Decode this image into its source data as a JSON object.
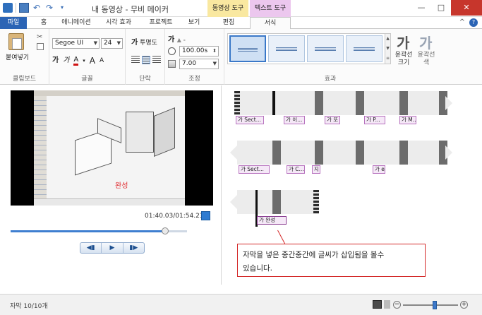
{
  "window": {
    "title": "내 동영상 - 무비 메이커",
    "context_tabs": [
      "동영상 도구",
      "텍스트 도구"
    ],
    "minimize": "—",
    "maximize": "□",
    "close": "✕"
  },
  "ribbon_tabs": {
    "file": "파일",
    "items": [
      "홈",
      "애니메이션",
      "시각 효과",
      "프로젝트",
      "보기",
      "편집",
      "서식"
    ],
    "active": "서식",
    "collapse": "^",
    "help": "?"
  },
  "clipboard": {
    "paste_label": "붙여넣기",
    "group_label": "클립보드"
  },
  "font": {
    "family": "Segoe UI",
    "size": "24",
    "bold": "가",
    "italic": "가",
    "color": "A",
    "grow": "A",
    "shrink": "A",
    "group_label": "글꼴"
  },
  "paragraph": {
    "transparency_label": "투명도",
    "group_label": "단락"
  },
  "adjust": {
    "start_time": "100.00s",
    "duration": "7.00",
    "group_label": "조정"
  },
  "effects": {
    "group_label": "효과",
    "outline_size": "윤곽선 크기",
    "outline_color": "윤곽선 색",
    "ga": "가",
    "selected_index": 0
  },
  "preview": {
    "video_caption": "완성",
    "time_readout": "01:40.03/01:54.23",
    "seek_position": 0.876,
    "transport": [
      "◀▮",
      "▶",
      "▮▶"
    ]
  },
  "storyboard": {
    "row1_captions": [
      "가 Sect...",
      "가 이...",
      "가 또",
      "가 P...",
      "가 M..."
    ],
    "row2_captions": [
      "가 Sect...",
      "가 C...",
      "지",
      "가 e"
    ],
    "row3_captions": [
      "가 완성"
    ],
    "note_line1": "자막을 넣은 중간중간에 글씨가 삽입됨을 볼수",
    "note_line2": "있습니다."
  },
  "statusbar": {
    "text": "자막 10/10개",
    "zoom_out": "−",
    "zoom_in": "+",
    "zoom_level": 0.58
  }
}
